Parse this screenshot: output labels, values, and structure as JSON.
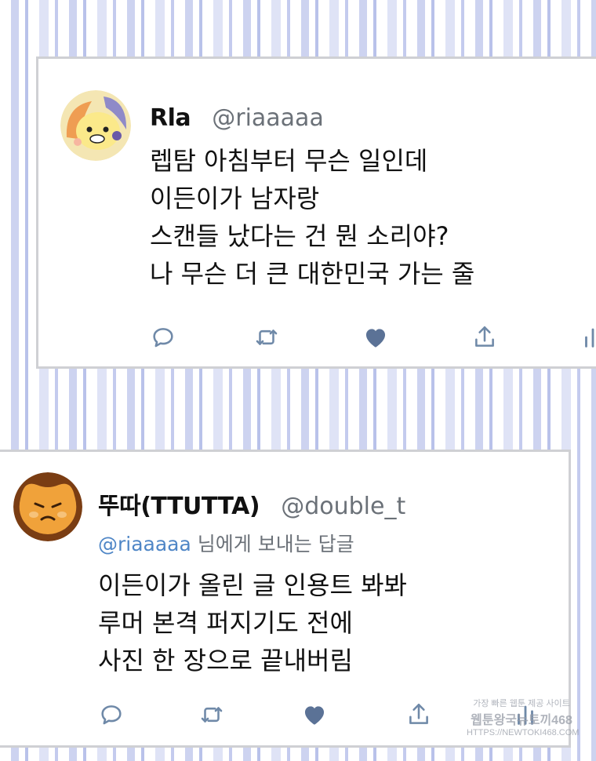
{
  "tweets": [
    {
      "author": {
        "name": "Rla",
        "handle": "@riaaaaa"
      },
      "lines": [
        "렙탐 아침부터 무슨 일인데",
        "이든이가 남자랑",
        "스캔들 났다는 건 뭔 소리야?",
        "나 무슨 더 큰 대한민국 가는 줄"
      ],
      "actions": [
        "reply-icon",
        "retweet-icon",
        "like-icon",
        "share-icon",
        "analytics-icon"
      ],
      "liked": true
    },
    {
      "author": {
        "name": "뚜따(TTUTTA)",
        "handle": "@double_t"
      },
      "reply_to": {
        "handle": "@riaaaaa",
        "suffix": " 님에게 보내는 답글"
      },
      "lines": [
        "이든이가 올린 글 인용트 봐봐",
        "루머 본격 퍼지기도 전에",
        "사진 한 장으로 끝내버림"
      ],
      "actions": [
        "reply-icon",
        "retweet-icon",
        "like-icon",
        "share-icon",
        "analytics-icon"
      ],
      "liked": true
    }
  ],
  "watermark": {
    "line1": "가장 빠른 웹툰 제공 사이트",
    "line2": "웹툰왕국뉴토끼468",
    "line3": "HTTPS://NEWTOKI468.COM"
  },
  "colors": {
    "icon": "#6f89a8",
    "like_filled": "#5b7296",
    "link": "#4f86c6",
    "muted_text": "#6b7178",
    "card_border": "#cfd0d4"
  }
}
